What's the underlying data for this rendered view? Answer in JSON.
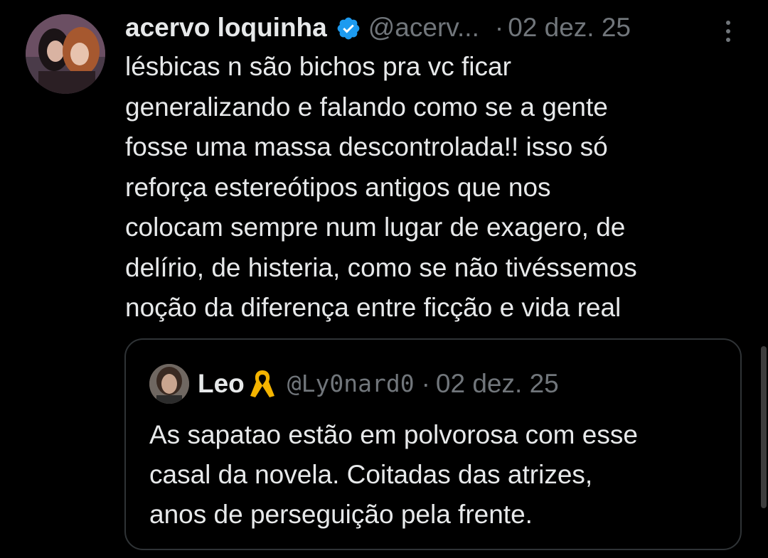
{
  "tweet": {
    "author_name": "acervo loquinha",
    "handle": "@acerv...",
    "separator": "·",
    "date": "02 dez. 25",
    "text_lines": [
      "lésbicas n são bichos pra vc ficar",
      "generalizando e falando como se a gente",
      "fosse uma massa descontrolada!! isso só",
      "reforça estereótipos antigos que nos",
      "colocam sempre num lugar de exagero, de",
      "delírio, de histeria, como se não tivéssemos",
      "noção da diferença entre ficção e vida real"
    ]
  },
  "quoted_tweet": {
    "author_name": "Leo",
    "handle": "@Ly0nard0",
    "separator": "·",
    "date": "02 dez. 25",
    "text_lines": [
      "As sapatao estão em polvorosa com esse",
      "casal da novela. Coitadas das atrizes,",
      "anos de perseguição pela frente."
    ]
  },
  "icons": {
    "verified": "verified-badge-icon",
    "more": "more-options-icon",
    "ribbon": "yellow-ribbon-icon"
  },
  "colors": {
    "background": "#000000",
    "text": "#e7e9ea",
    "secondary": "#71767b",
    "verified": "#1d9bf0",
    "border": "#2f3336",
    "ribbon": "#f4b400"
  }
}
